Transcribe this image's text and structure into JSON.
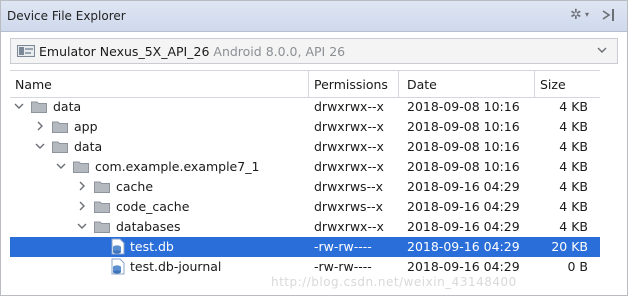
{
  "panel": {
    "title": "Device File Explorer"
  },
  "device": {
    "name": "Emulator Nexus_5X_API_26",
    "meta": "Android 8.0.0, API 26"
  },
  "columns": [
    "Name",
    "Permissions",
    "Date",
    "Size"
  ],
  "rows": [
    {
      "name": "data",
      "depth": 0,
      "state": "expanded",
      "kind": "folder",
      "perm": "drwxrwx--x",
      "date": "2018-09-08 10:16",
      "size": "4 KB"
    },
    {
      "name": "app",
      "depth": 1,
      "state": "collapsed",
      "kind": "folder",
      "perm": "drwxrwx--x",
      "date": "2018-09-08 10:16",
      "size": "4 KB"
    },
    {
      "name": "data",
      "depth": 1,
      "state": "expanded",
      "kind": "folder",
      "perm": "drwxrwx--x",
      "date": "2018-09-08 10:16",
      "size": "4 KB"
    },
    {
      "name": "com.example.example7_1",
      "depth": 2,
      "state": "expanded",
      "kind": "folder",
      "perm": "drwxrwx--x",
      "date": "2018-09-08 10:16",
      "size": "4 KB"
    },
    {
      "name": "cache",
      "depth": 3,
      "state": "collapsed",
      "kind": "folder",
      "perm": "drwxrws--x",
      "date": "2018-09-16 04:29",
      "size": "4 KB"
    },
    {
      "name": "code_cache",
      "depth": 3,
      "state": "collapsed",
      "kind": "folder",
      "perm": "drwxrws--x",
      "date": "2018-09-16 04:29",
      "size": "4 KB"
    },
    {
      "name": "databases",
      "depth": 3,
      "state": "expanded",
      "kind": "folder",
      "perm": "drwxrwx--x",
      "date": "2018-09-16 04:29",
      "size": "4 KB"
    },
    {
      "name": "test.db",
      "depth": 4,
      "state": "leaf",
      "kind": "db",
      "perm": "-rw-rw----",
      "date": "2018-09-16 04:29",
      "size": "20 KB",
      "selected": true
    },
    {
      "name": "test.db-journal",
      "depth": 4,
      "state": "leaf",
      "kind": "db",
      "perm": "-rw-rw----",
      "date": "2018-09-16 04:29",
      "size": "0 B"
    }
  ],
  "watermark": "http://blog.csdn.net/weixin_43148400",
  "icons": {
    "gear": "gear-icon",
    "pin": "hide-panel-icon",
    "device": "emulator-icon",
    "folder": "folder-icon",
    "db": "database-file-icon"
  },
  "colors": {
    "selection": "#2a6ed9",
    "header": "#d7e0f0"
  }
}
